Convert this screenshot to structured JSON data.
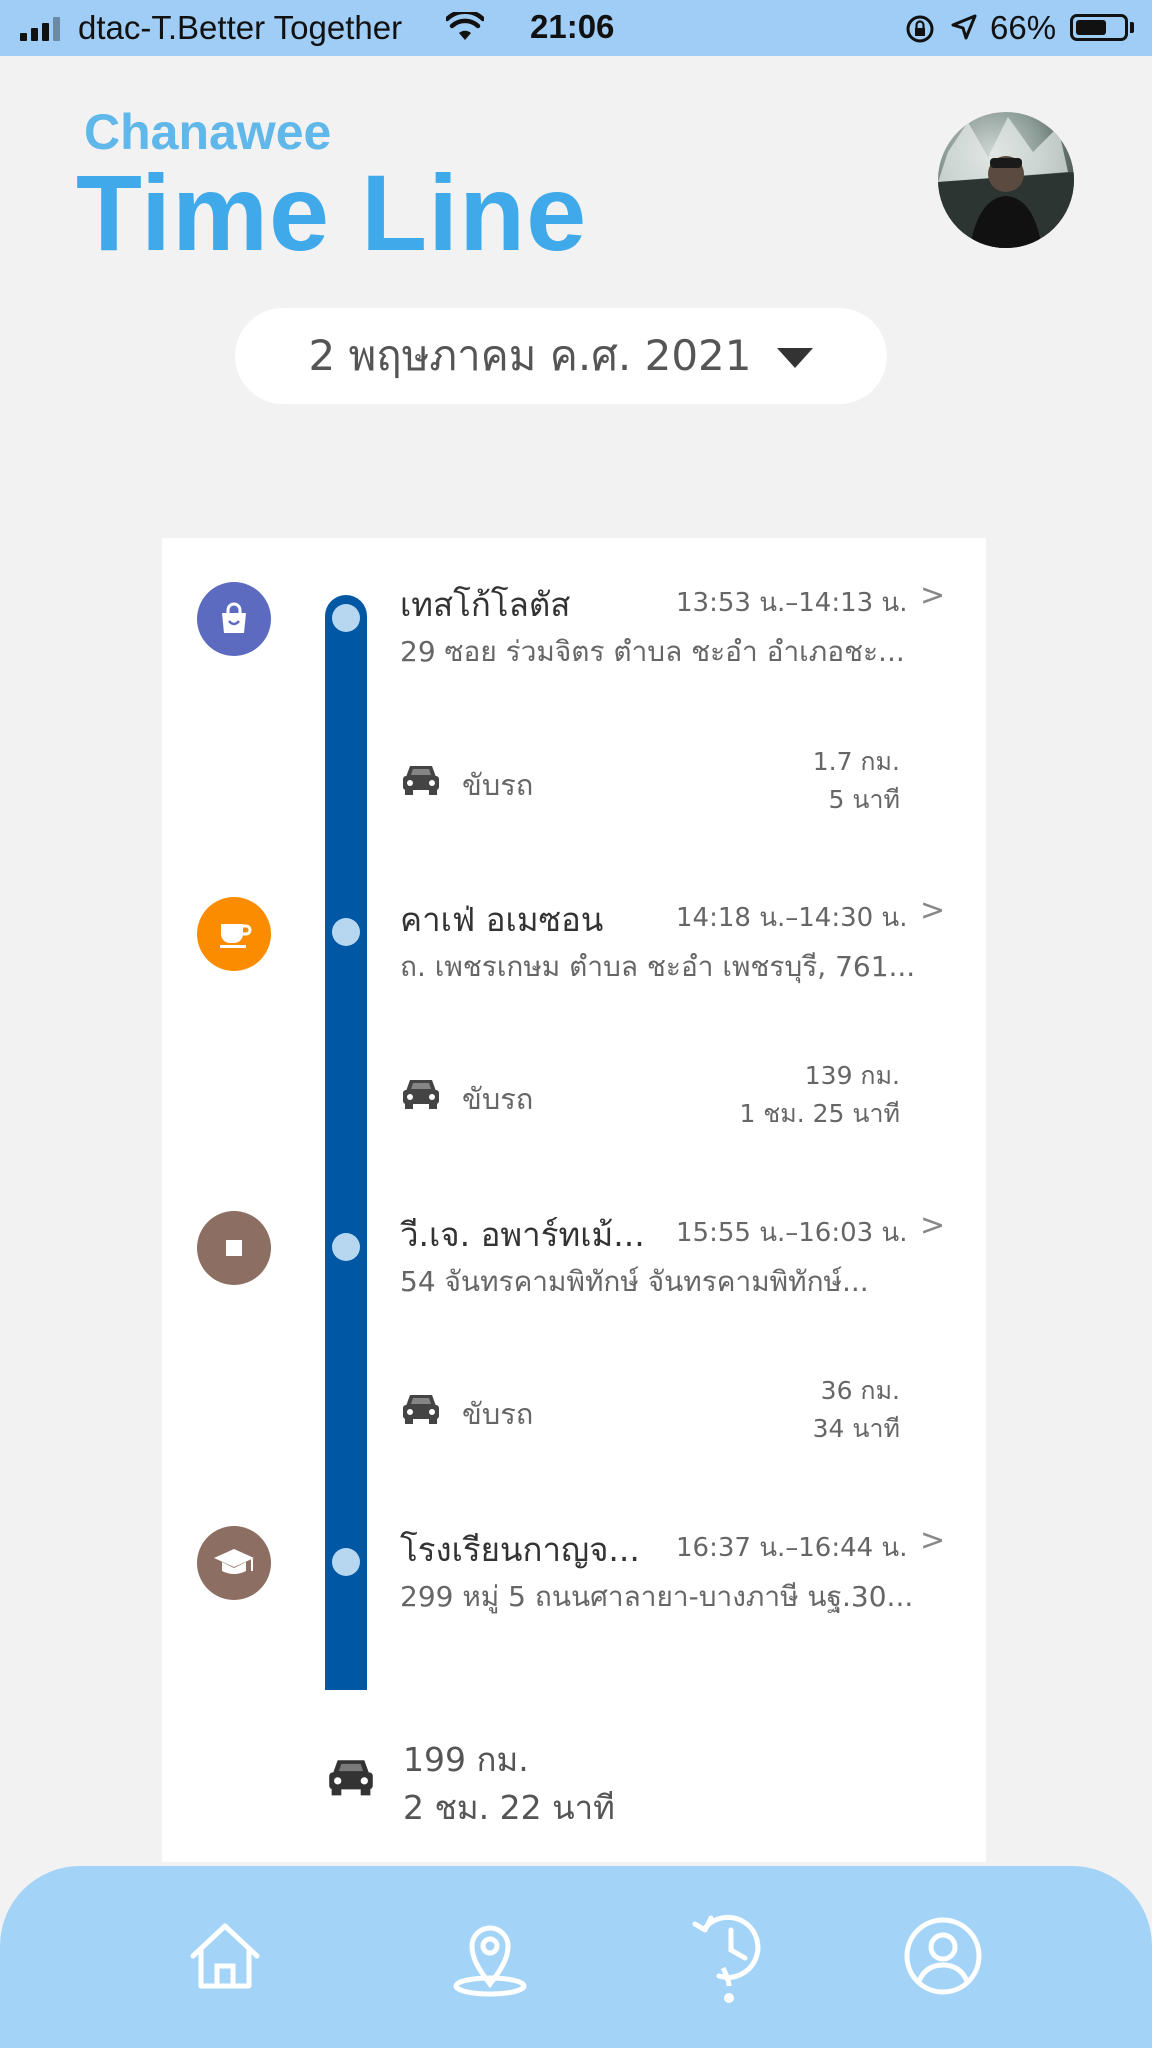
{
  "status_bar": {
    "carrier": "dtac-T.Better Together",
    "time": "21:06",
    "battery_percent": "66%",
    "battery_level": 0.66
  },
  "header": {
    "user_name": "Chanawee",
    "title": "Time Line"
  },
  "date_selector": {
    "label": "2 พฤษภาคม ค.ศ. 2021"
  },
  "timeline": {
    "places": [
      {
        "name": "เทสโก้โลตัส",
        "time": "13:53 น.–14:13 น.",
        "address": "29 ซอย ร่วมจิตร ตำบล ชะอำ อำเภอชะ...",
        "icon": "shopping-bag-icon",
        "color": "#5c6bc0"
      },
      {
        "name": "คาเฟ่ อเมซอน",
        "time": "14:18 น.–14:30 น.",
        "address": "ถ. เพชรเกษม ตำบล ชะอำ เพชรบุรี, 761...",
        "icon": "coffee-cup-icon",
        "color": "#fb8c00"
      },
      {
        "name": "วี.เจ. อพาร์ทเม้...",
        "time": "15:55 น.–16:03 น.",
        "address": "54 จันทรคามพิทักษ์ จันทรคามพิทักษ์...",
        "icon": "stop-square-icon",
        "color": "#8d6e63"
      },
      {
        "name": "โรงเรียนกาญจ...",
        "time": "16:37 น.–16:44 น.",
        "address": "299 หมู่ 5 ถนนศาลายา-บางภาษี นฐ.30...",
        "icon": "graduation-cap-icon",
        "color": "#8d6e63"
      }
    ],
    "segments": [
      {
        "mode": "ขับรถ",
        "distance": "1.7 กม.",
        "duration": "5 นาที",
        "icon": "car-icon"
      },
      {
        "mode": "ขับรถ",
        "distance": "139 กม.",
        "duration": "1 ชม. 25 นาที",
        "icon": "car-icon"
      },
      {
        "mode": "ขับรถ",
        "distance": "36 กม.",
        "duration": "34 นาที",
        "icon": "car-icon"
      }
    ],
    "total": {
      "distance": "199 กม.",
      "duration": "2 ชม. 22 นาที",
      "icon": "car-icon"
    },
    "chevron": ">"
  },
  "bottom_nav": {
    "items": [
      "home-icon",
      "location-pin-icon",
      "history-icon",
      "profile-icon"
    ]
  }
}
